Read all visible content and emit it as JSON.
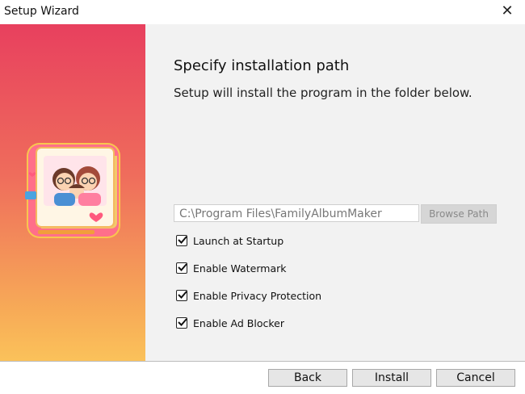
{
  "window": {
    "title": "Setup Wizard"
  },
  "page": {
    "heading": "Specify installation path",
    "subtext": "Setup will install the program in the folder below."
  },
  "path": {
    "value": "C:\\Program Files\\FamilyAlbumMaker",
    "browse_label": "Browse Path"
  },
  "options": [
    {
      "label": "Launch at Startup",
      "checked": true
    },
    {
      "label": "Enable Watermark",
      "checked": true
    },
    {
      "label": "Enable Privacy Protection",
      "checked": true
    },
    {
      "label": "Enable Ad Blocker",
      "checked": true
    }
  ],
  "buttons": {
    "back": "Back",
    "install": "Install",
    "cancel": "Cancel"
  },
  "icons": {
    "close": "close-icon",
    "app": "family-album-icon",
    "check": "checkmark-icon"
  },
  "colors": {
    "sidebar_top": "#e8405e",
    "sidebar_bottom": "#fbc25a",
    "content_bg": "#f2f2f2"
  }
}
